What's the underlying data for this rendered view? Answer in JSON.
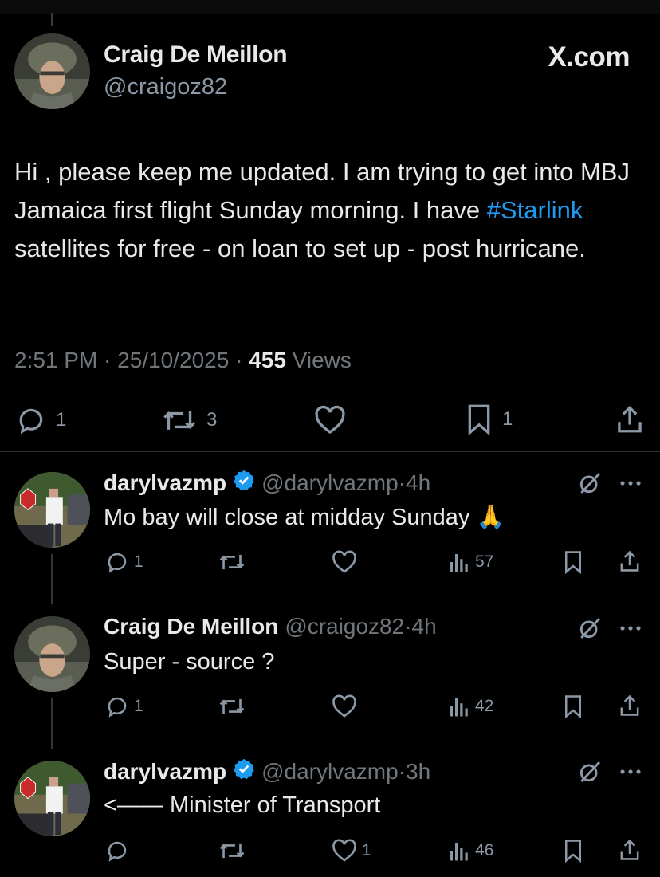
{
  "main_tweet": {
    "author_name": "Craig De Meillon",
    "handle": "@craigoz82",
    "site_label": "X.com",
    "text_before": "Hi , please keep me updated. I am trying to get into MBJ Jamaica first flight Sunday morning. I have ",
    "hashtag": "#Starlink",
    "text_after": " satellites for free - on loan to set up - post hurricane.",
    "time": "2:51 PM",
    "date": "25/10/2025",
    "views_count": "455",
    "views_label": "Views",
    "replies": "1",
    "reposts": "3",
    "bookmarks": "1"
  },
  "replies": [
    {
      "name": "darylvazmp",
      "verified": true,
      "handle": "@darylvazmp",
      "age": "4h",
      "text": "Mo bay will close at midday Sunday 🙏",
      "replies": "1",
      "reposts": "",
      "likes": "",
      "views": "57"
    },
    {
      "name": "Craig De Meillon",
      "verified": false,
      "handle": "@craigoz82",
      "age": "4h",
      "text": "Super - source ?",
      "replies": "1",
      "reposts": "",
      "likes": "",
      "views": "42"
    },
    {
      "name": "darylvazmp",
      "verified": true,
      "handle": "@darylvazmp",
      "age": "3h",
      "text": "<—— Minister of Transport",
      "replies": "",
      "reposts": "",
      "likes": "1",
      "views": "46"
    }
  ],
  "separator": " · ",
  "colors": {
    "background": "#000000",
    "text": "#e7e9ea",
    "muted": "#71767b",
    "accent": "#1d9bf0"
  },
  "icons": [
    "reply-icon",
    "repost-icon",
    "like-icon",
    "bookmark-icon",
    "share-icon",
    "views-icon",
    "grok-icon",
    "more-icon",
    "verified-icon"
  ]
}
